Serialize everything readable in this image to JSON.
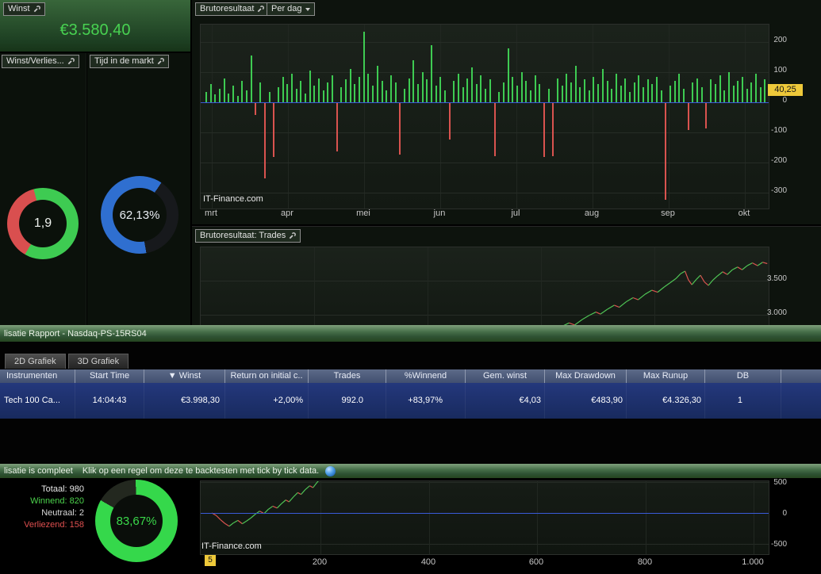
{
  "colors": {
    "bar_up": "#3ecb52",
    "bar_down": "#d9534f",
    "equity_up": "#4fc455",
    "equity_down": "#d9534f",
    "zero_line_blue": "#3a5bd9",
    "selection_blue": "#24387c",
    "titlebar_green": "#47704a",
    "highlight_yellow": "#eec93a",
    "profit_green": "#48d251"
  },
  "top_left": {
    "winst_label": "Winst",
    "winst_value": "€3.580,40",
    "winst_verlies_label": "Winst/Verlies...",
    "tijd_label": "Tijd in de markt"
  },
  "donuts": [
    {
      "name": "profit-loss-ratio",
      "label": "1,9",
      "label_color": "#eef2ee",
      "stops": [
        {
          "color": "#3ecb52",
          "from": 0,
          "to": 210
        },
        {
          "color": "#d94f4f",
          "from": 210,
          "to": 345
        },
        {
          "color": "#3ecb52",
          "from": 345,
          "to": 360
        }
      ]
    },
    {
      "name": "time-in-market",
      "label": "62,13%",
      "label_color": "#e8edf2",
      "stops": [
        {
          "color": "#2f6fd0",
          "from": 0,
          "to": 34
        },
        {
          "color": "#17191c",
          "from": 34,
          "to": 170
        },
        {
          "color": "#2f6fd0",
          "from": 170,
          "to": 360
        }
      ]
    },
    {
      "name": "win-rate",
      "label": "83,67%",
      "label_color": "#3ad84a",
      "stops": [
        {
          "color": "#35d84b",
          "from": 0,
          "to": 300
        },
        {
          "color": "#23281f",
          "from": 300,
          "to": 359
        },
        {
          "color": "#35d84b",
          "from": 359,
          "to": 360
        }
      ]
    }
  ],
  "chart_data": [
    {
      "id": "daily_gross_result",
      "type": "bar",
      "title": "Brutoresultaat",
      "mode": "Per dag",
      "x_axis_labels": [
        "mrt",
        "apr",
        "mei",
        "jun",
        "jul",
        "aug",
        "sep",
        "okt"
      ],
      "y_ticks": [
        200,
        100,
        0,
        -100,
        -200,
        -300
      ],
      "ylim": [
        -347,
        250
      ],
      "current_value_label": "40,25",
      "watermark": "IT-Finance.com",
      "values": [
        35,
        60,
        25,
        45,
        80,
        30,
        55,
        20,
        70,
        40,
        155,
        -40,
        65,
        -250,
        35,
        -180,
        50,
        85,
        60,
        95,
        45,
        70,
        30,
        105,
        55,
        80,
        40,
        65,
        90,
        -160,
        50,
        75,
        110,
        60,
        85,
        235,
        95,
        55,
        120,
        70,
        40,
        90,
        65,
        -170,
        45,
        80,
        140,
        60,
        100,
        75,
        190,
        55,
        85,
        40,
        -120,
        70,
        95,
        50,
        80,
        115,
        60,
        90,
        45,
        75,
        -175,
        35,
        65,
        180,
        85,
        55,
        100,
        70,
        40,
        90,
        60,
        -180,
        45,
        -175,
        80,
        55,
        95,
        65,
        120,
        50,
        75,
        40,
        85,
        60,
        110,
        70,
        45,
        95,
        55,
        80,
        35,
        65,
        90,
        50,
        75,
        60,
        85,
        40,
        -320,
        55,
        70,
        95,
        45,
        -90,
        65,
        80,
        50,
        -85,
        75,
        60,
        90,
        40,
        100,
        55,
        70,
        85,
        45,
        65,
        95,
        50,
        75
      ]
    },
    {
      "id": "gross_result_per_trade",
      "type": "line",
      "title": "Brutoresultaat: Trades",
      "y_ticks": [
        "3.500",
        "3.000"
      ],
      "ylim": [
        2825,
        3990
      ],
      "points": [
        [
          600,
          2700
        ],
        [
          615,
          2760
        ],
        [
          630,
          2820
        ],
        [
          645,
          2880
        ],
        [
          655,
          2850
        ],
        [
          668,
          2930
        ],
        [
          680,
          2990
        ],
        [
          692,
          3040
        ],
        [
          700,
          3010
        ],
        [
          712,
          3080
        ],
        [
          724,
          3140
        ],
        [
          733,
          3110
        ],
        [
          745,
          3190
        ],
        [
          757,
          3250
        ],
        [
          766,
          3220
        ],
        [
          778,
          3300
        ],
        [
          790,
          3360
        ],
        [
          800,
          3330
        ],
        [
          812,
          3410
        ],
        [
          822,
          3470
        ],
        [
          832,
          3530
        ],
        [
          840,
          3600
        ],
        [
          848,
          3640
        ],
        [
          854,
          3510
        ],
        [
          860,
          3440
        ],
        [
          868,
          3520
        ],
        [
          875,
          3580
        ],
        [
          882,
          3480
        ],
        [
          889,
          3430
        ],
        [
          897,
          3510
        ],
        [
          905,
          3570
        ],
        [
          914,
          3630
        ],
        [
          922,
          3590
        ],
        [
          931,
          3660
        ],
        [
          940,
          3700
        ],
        [
          948,
          3660
        ],
        [
          957,
          3720
        ],
        [
          966,
          3760
        ],
        [
          975,
          3720
        ],
        [
          984,
          3770
        ],
        [
          992,
          3750
        ]
      ]
    },
    {
      "id": "backtest_equity",
      "type": "line",
      "x_ticks": [
        "200",
        "400",
        "600",
        "800",
        "1.000"
      ],
      "y_ticks": [
        "500",
        "0",
        "-500"
      ],
      "start_label": "5",
      "watermark": "IT-Finance.com",
      "points": [
        [
          0,
          0
        ],
        [
          8,
          -40
        ],
        [
          16,
          -110
        ],
        [
          24,
          -170
        ],
        [
          32,
          -215
        ],
        [
          40,
          -160
        ],
        [
          48,
          -120
        ],
        [
          56,
          -175
        ],
        [
          64,
          -130
        ],
        [
          72,
          -80
        ],
        [
          80,
          -20
        ],
        [
          88,
          30
        ],
        [
          96,
          -10
        ],
        [
          104,
          60
        ],
        [
          112,
          110
        ],
        [
          120,
          80
        ],
        [
          128,
          150
        ],
        [
          136,
          210
        ],
        [
          142,
          180
        ],
        [
          150,
          260
        ],
        [
          158,
          330
        ],
        [
          164,
          300
        ],
        [
          172,
          380
        ],
        [
          180,
          440
        ],
        [
          186,
          410
        ],
        [
          194,
          500
        ],
        [
          200,
          560
        ],
        [
          206,
          620
        ]
      ]
    }
  ],
  "report": {
    "window_title": "lisatie Rapport - Nasdaq-PS-15RS04",
    "tabs": [
      "2D Grafiek",
      "3D Grafiek"
    ],
    "columns": [
      "Instrumenten",
      "Start Time",
      "▼ Winst",
      "Return on initial c..",
      "Trades",
      "%Winnend",
      "Gem. winst",
      "Max Drawdown",
      "Max Runup",
      "DB"
    ],
    "rows": [
      [
        "Tech 100 Ca...",
        "14:04:43",
        "€3.998,30",
        "+2,00%",
        "992.0",
        "+83,97%",
        "€4,03",
        "€483,90",
        "€4.326,30",
        "1"
      ]
    ]
  },
  "status": {
    "left_text": "lisatie is compleet",
    "message": "Klik op een regel om deze te backtesten met tick by tick data."
  },
  "stats": {
    "items": [
      {
        "label": "Totaal:",
        "value": "980",
        "color": "#e8e8e8"
      },
      {
        "label": "Winnend:",
        "value": "820",
        "color": "#4cd24c"
      },
      {
        "label": "Neutraal:",
        "value": "2",
        "color": "#d8d8d8"
      },
      {
        "label": "Verliezend:",
        "value": "158",
        "color": "#e05050"
      }
    ]
  }
}
